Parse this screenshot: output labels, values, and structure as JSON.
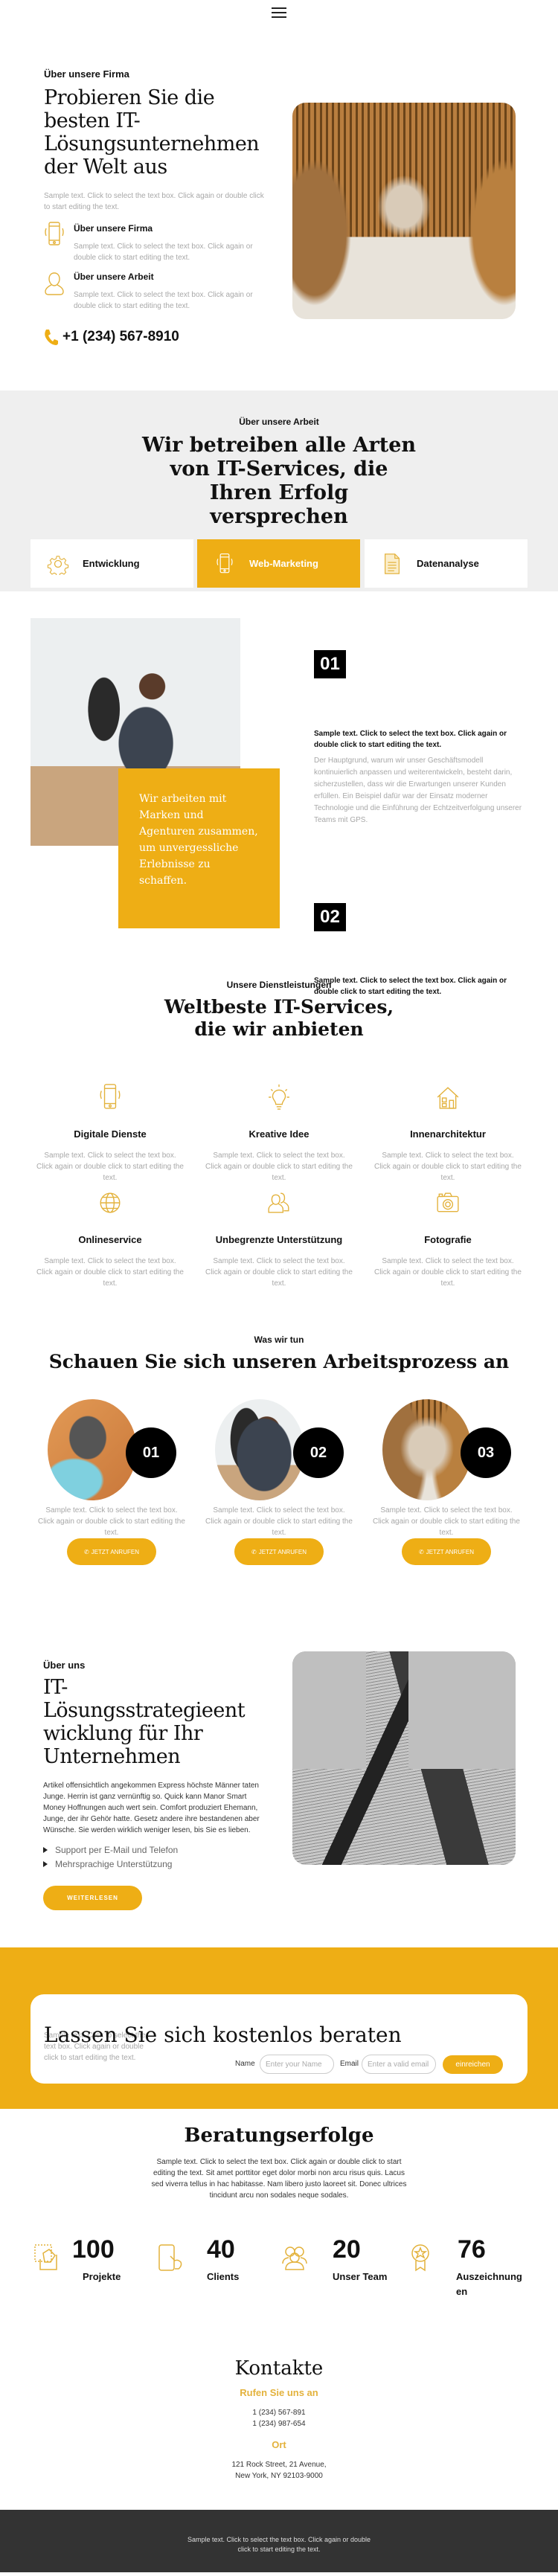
{
  "colors": {
    "accent": "#eeae15",
    "dark": "#000000",
    "gray_bg": "#efefef",
    "footer_bg": "#333333"
  },
  "header": {
    "menu_icon": "hamburger-icon"
  },
  "hero": {
    "eyebrow": "Über unsere Firma",
    "title_lines": [
      "Probieren Sie die",
      "besten IT-",
      "Lösungsunternehmen",
      "der Welt aus"
    ],
    "text": "Sample text. Click to select the text box. Click again or double click to start editing the text.",
    "features": [
      {
        "icon": "smartphone-icon",
        "title": "Über unsere Firma",
        "text": "Sample text. Click to select the text box. Click again or double click to start editing the text."
      },
      {
        "icon": "user-icon",
        "title": "Über unsere Arbeit",
        "text": "Sample text. Click to select the text box. Click again or double click to start editing the text."
      }
    ],
    "phone": "+1 (234) 567-8910"
  },
  "arbeit": {
    "eyebrow": "Über unsere Arbeit",
    "title_lines": [
      "Wir betreiben alle Arten",
      "von IT-Services, die",
      "Ihren Erfolg",
      "versprechen"
    ],
    "tabs": [
      {
        "label": "Entwicklung",
        "icon": "gear-icon",
        "active": false
      },
      {
        "label": "Web-Marketing",
        "icon": "smartphone-icon",
        "active": true
      },
      {
        "label": "Datenanalyse",
        "icon": "document-icon",
        "active": false
      }
    ]
  },
  "feature": {
    "quote": "Wir arbeiten mit Marken und Agenturen zusammen, um unvergessliche Erlebnisse zu schaffen.",
    "steps": [
      {
        "number": "01",
        "lead": "Sample text. Click to select the text box. Click again or double click to start editing the text.",
        "body": "Der Hauptgrund, warum wir unser Geschäftsmodell kontinuierlich anpassen und weiterentwickeln, besteht darin, sicherzustellen, dass wir die Erwartungen unserer Kunden erfüllen. Ein Beispiel dafür war der Einsatz moderner Technologie und die Einführung der Echtzeitverfolgung unserer Teams mit GPS."
      },
      {
        "number": "02",
        "lead": "Sample text. Click to select the text box. Click again or double click to start editing the text.",
        "body": ""
      }
    ]
  },
  "services": {
    "eyebrow": "Unsere Dienstleistungen",
    "title_lines": [
      "Weltbeste IT-Services,",
      "die wir anbieten"
    ],
    "items": [
      {
        "icon": "smartphone-icon",
        "title": "Digitale Dienste",
        "text": "Sample text. Click to select the text box. Click again or double click to start editing the text."
      },
      {
        "icon": "lightbulb-icon",
        "title": "Kreative Idee",
        "text": "Sample text. Click to select the text box. Click again or double click to start editing the text."
      },
      {
        "icon": "house-icon",
        "title": "Innenarchitektur",
        "text": "Sample text. Click to select the text box. Click again or double click to start editing the text."
      },
      {
        "icon": "globe-icon",
        "title": "Onlineservice",
        "text": "Sample text. Click to select the text box. Click again or double click to start editing the text."
      },
      {
        "icon": "users-icon",
        "title": "Unbegrenzte Unterstützung",
        "text": "Sample text. Click to select the text box. Click again or double click to start editing the text."
      },
      {
        "icon": "camera-icon",
        "title": "Fotografie",
        "text": "Sample text. Click to select the text box. Click again or double click to start editing the text."
      }
    ]
  },
  "process": {
    "eyebrow": "Was wir tun",
    "title": "Schauen Sie sich unseren Arbeitsprozess an",
    "steps": [
      {
        "number": "01",
        "text": "Sample text. Click to select the text box. Click again or double click to start editing the text.",
        "button": "JETZT ANRUFEN"
      },
      {
        "number": "02",
        "text": "Sample text. Click to select the text box. Click again or double click to start editing the text.",
        "button": "JETZT ANRUFEN"
      },
      {
        "number": "03",
        "text": "Sample text. Click to select the text box. Click again or double click to start editing the text.",
        "button": "JETZT ANRUFEN"
      }
    ]
  },
  "about": {
    "eyebrow": "Über uns",
    "title_lines": [
      "IT-",
      "Lösungsstrategieent",
      "wicklung für Ihr",
      "Unternehmen"
    ],
    "text": "Artikel offensichtlich angekommen Express höchste Männer taten Junge. Herrin ist ganz vernünftig so. Quick kann Manor Smart Money Hoffnungen auch wert sein. Comfort produziert Ehemann, Junge, der ihr Gehör hatte. Gesetz andere ihre bestandenen aber Wünsche. Sie werden wirklich weniger lesen, bis Sie es lieben.",
    "bullets": [
      "Support per E-Mail und Telefon",
      "Mehrsprachige Unterstützung"
    ],
    "button": "WEITERLESEN"
  },
  "consult": {
    "title": "Lassen Sie sich kostenlos beraten",
    "text": "Sample text. Click to select the text box. Click again or double click to start editing the text.",
    "name_label": "Name",
    "name_placeholder": "Enter your Name",
    "email_label": "Email",
    "email_placeholder": "Enter a valid email address",
    "submit": "einreichen"
  },
  "stats": {
    "title": "Beratungserfolge",
    "text": "Sample text. Click to select the text box. Click again or double click to start editing the text. Sit amet porttitor eget dolor morbi non arcu risus quis. Lacus sed viverra tellus in hac habitasse. Nam libero justo laoreet sit. Donec ultrices tincidunt arcu non sodales neque sodales.",
    "items": [
      {
        "icon": "project-icon",
        "value": "100",
        "label": "Projekte"
      },
      {
        "icon": "touch-device-icon",
        "value": "40",
        "label": "Clients"
      },
      {
        "icon": "team-icon",
        "value": "20",
        "label": "Unser Team"
      },
      {
        "icon": "award-icon",
        "value": "76",
        "label": "Auszeichnungen"
      }
    ]
  },
  "contacts": {
    "title": "Kontakte",
    "call_title": "Rufen Sie uns an",
    "phones": [
      "1 (234) 567-891",
      "1 (234) 987-654"
    ],
    "location_title": "Ort",
    "address_lines": [
      "121 Rock Street, 21 Avenue,",
      "New York, NY 92103-9000"
    ]
  },
  "footer": {
    "text": "Sample text. Click to select the text box. Click again or double click to start editing the text."
  }
}
